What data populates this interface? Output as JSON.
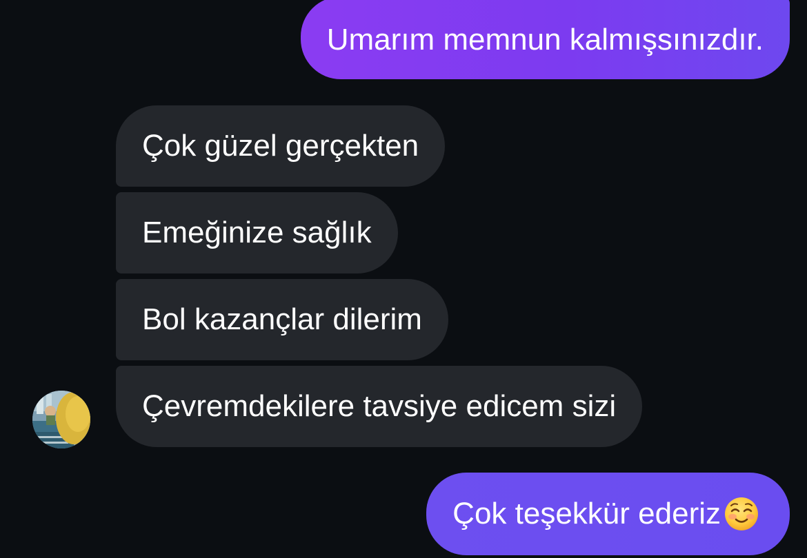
{
  "conversation": {
    "messages": [
      {
        "direction": "outgoing",
        "text": "Umarım memnun kalmışsınızdır."
      },
      {
        "direction": "incoming",
        "text": "Çok güzel gerçekten"
      },
      {
        "direction": "incoming",
        "text": "Emeğinize sağlık"
      },
      {
        "direction": "incoming",
        "text": "Bol kazançlar dilerim"
      },
      {
        "direction": "incoming",
        "text": "Çevremdekilere tavsiye edicem sizi"
      },
      {
        "direction": "outgoing",
        "text": "Çok teşekkür ederiz",
        "emoji": "smiling-face-icon"
      }
    ]
  },
  "colors": {
    "background": "#0b0e12",
    "outgoing_bubble": "#7c3bf0",
    "incoming_bubble": "#24272c",
    "text": "#ffffff"
  },
  "icons": {
    "avatar": "contact-avatar",
    "emoji": "smiling-face-icon"
  }
}
